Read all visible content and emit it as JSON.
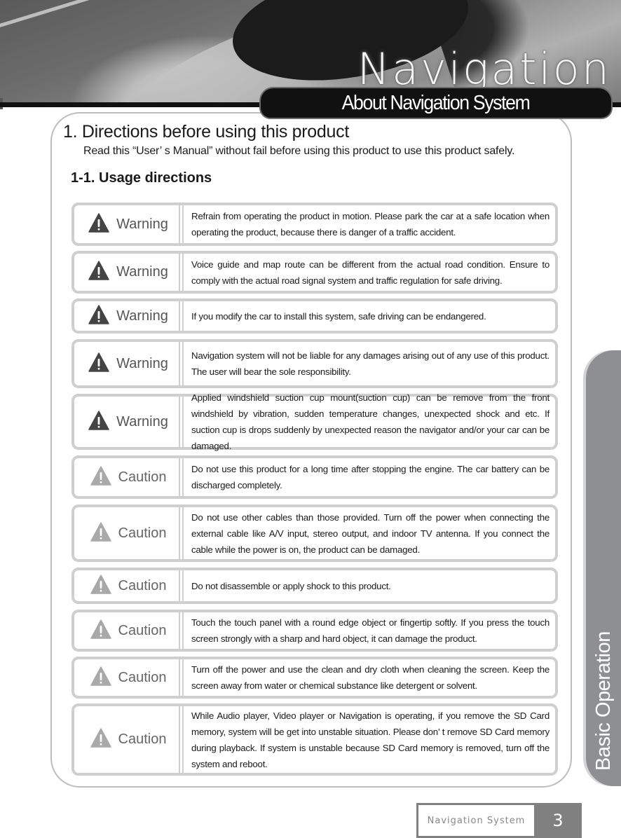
{
  "header": {
    "banner_title": "Navigation",
    "section_title": "About Navigation System"
  },
  "content": {
    "heading": "1. Directions before using this product",
    "intro": "Read this “User’ s Manual” without fail before using this product to use this product safely.",
    "subheading": "1-1. Usage directions",
    "notices": [
      {
        "type": "warning",
        "icon": "warning-triangle-icon",
        "label": "Warning",
        "text": "Refrain from operating the product in motion. Please park the car at a safe location when operating the product, because there is danger of a traffic accident."
      },
      {
        "type": "warning",
        "icon": "warning-triangle-icon",
        "label": "Warning",
        "text": "Voice guide and map route can be different from the actual road condition. Ensure to comply with the actual road signal system and traffic regulation for safe driving."
      },
      {
        "type": "warning",
        "icon": "warning-triangle-icon",
        "label": "Warning",
        "text": "If you modify the car to install this system, safe driving can be endangered."
      },
      {
        "type": "warning",
        "icon": "warning-triangle-icon",
        "label": "Warning",
        "text": "Navigation system will not be liable for any damages arising out of any use of this product. The user will bear the sole responsibility."
      },
      {
        "type": "warning",
        "icon": "warning-triangle-icon",
        "label": "Warning",
        "text": "Applied windshield suction cup mount(suction cup) can be remove from the front windshield by vibration, sudden temperature changes, unexpected shock and etc. If suction cup is drops suddenly by unexpected reason the navigator and/or your car can be damaged."
      },
      {
        "type": "caution",
        "icon": "caution-triangle-icon",
        "label": "Caution",
        "text": "Do not use this product for a long time after stopping the engine. The car battery can be discharged completely."
      },
      {
        "type": "caution",
        "icon": "caution-triangle-icon",
        "label": "Caution",
        "text": "Do not use other cables than those provided. Turn off the power when connecting the external cable like A/V input, stereo output, and indoor TV antenna. If you connect the cable while the power is on, the product can be damaged."
      },
      {
        "type": "caution",
        "icon": "caution-triangle-icon",
        "label": "Caution",
        "text": "Do not disassemble or apply shock to this product."
      },
      {
        "type": "caution",
        "icon": "caution-triangle-icon",
        "label": "Caution",
        "text": "Touch the touch panel with a round edge object or fingertip softly. If you press the touch screen strongly with a sharp and hard object, it can damage the product."
      },
      {
        "type": "caution",
        "icon": "caution-triangle-icon",
        "label": "Caution",
        "text": "Turn off the power and use the clean and dry cloth when cleaning the screen. Keep the screen away from water or chemical substance like detergent or solvent."
      },
      {
        "type": "caution",
        "icon": "caution-triangle-icon",
        "label": "Caution",
        "text": "While Audio player, Video player or Navigation is operating, if you remove the SD Card memory, system will be get into unstable situation. Please don’ t remove SD Card memory during playback. If system is unstable because SD Card memory is removed, turn off the system and reboot."
      }
    ]
  },
  "side_tab": {
    "label": "Basic Operation"
  },
  "footer": {
    "label": "Navigation System",
    "page_number": "3"
  },
  "colors": {
    "warning_icon": "#444444",
    "caution_icon": "#a9a9a9",
    "box_border": "#cfcfcf",
    "side_tab": "#8e8f93",
    "footer_bg": "#808080"
  }
}
